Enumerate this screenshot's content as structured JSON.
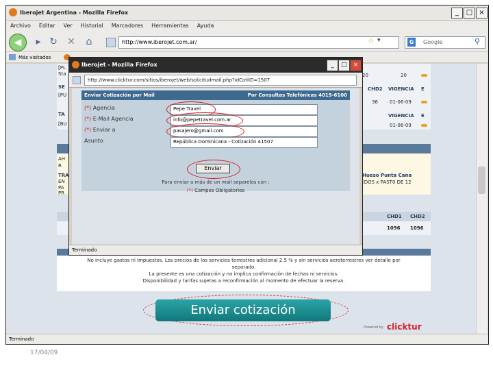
{
  "window": {
    "title": "Iberojet Argentina - Mozilla Firefox",
    "statusbar": "Terminado"
  },
  "menu": [
    "Archivo",
    "Editar",
    "Ver",
    "Historial",
    "Marcadores",
    "Herramientas",
    "Ayuda"
  ],
  "navbar": {
    "url": "http://www.iberojet.com.ar/",
    "search_placeholder": "Google"
  },
  "bookmarks": {
    "most_visited": "Más visitados"
  },
  "background_page": {
    "frag_pl1": "[PL",
    "frag_sta": "Sta",
    "frag_se": "SE",
    "frag_pu": "[PU",
    "frag_ta": "TA",
    "frag_bu": "[BU",
    "col1": "CHD2",
    "col2": "VIGENCIA",
    "col3": "E",
    "row1_n": "20",
    "row1_m": "20",
    "row2_a": "36",
    "row2_b": "01-06-09",
    "row3_b": "01-06-09",
    "block_left": [
      "AH",
      "R",
      "TRA",
      "EN",
      "PA",
      "PR"
    ],
    "block_right": [
      "Hueso Punta Cana",
      "[DOS x PAST0 DE 12"
    ],
    "tbl_h1": "CHD1",
    "tbl_h2": "CHD2",
    "tbl_v1": "1096",
    "tbl_v2": "1096",
    "footer_note1": "No incluye gastos ni impuestos. Los precios de los servicios terrestres adicional 2,5 % y sin servicios aeroterrestres ver detalle por",
    "footer_note2": "separado.",
    "footer_note3": "La presente es una cotización y no implica confirmación de fechas ni servicios.",
    "footer_note4": "Disponibilidad y tarifas sujetas a reconfirmación al momento de efectuar la reserva.",
    "enviar_button": "Enviar cotización",
    "powered_by": "Powered by",
    "brand": "clicktur"
  },
  "popup": {
    "title": "Iberojet - Mozilla Firefox",
    "url": "http://www.clicktur.com/sitios/iberojet/web/solicitudmail.php?idCotiID=1507",
    "header_left": "Enviar Cotización por Mail",
    "header_right": "Por Consultas Telefónicas 4019-6100",
    "fields": [
      {
        "required": "(*)",
        "label": "Agencia",
        "value": "Pepe Travel"
      },
      {
        "required": "(*)",
        "label": "E-Mail Agencia",
        "value": "info@pepetravel.com.ar"
      },
      {
        "required": "(*)",
        "label": "Enviar a",
        "value": "pasajero@gmail.com"
      },
      {
        "required": "",
        "label": "Asunto",
        "value": "República Dominicana - Cotización 41507"
      }
    ],
    "send_button": "Enviar",
    "note_multi": "Para enviar a más de un mail separelos con ;",
    "note_required_mark": "(*)",
    "note_required": "Campos Obligatorios",
    "status": "Terminado"
  },
  "slide_date": "17/04/09",
  "accent": {
    "title_bar": "#2b2b2b",
    "enviar": "#1a8a8d",
    "highlight_ring": "#d41a1a"
  }
}
